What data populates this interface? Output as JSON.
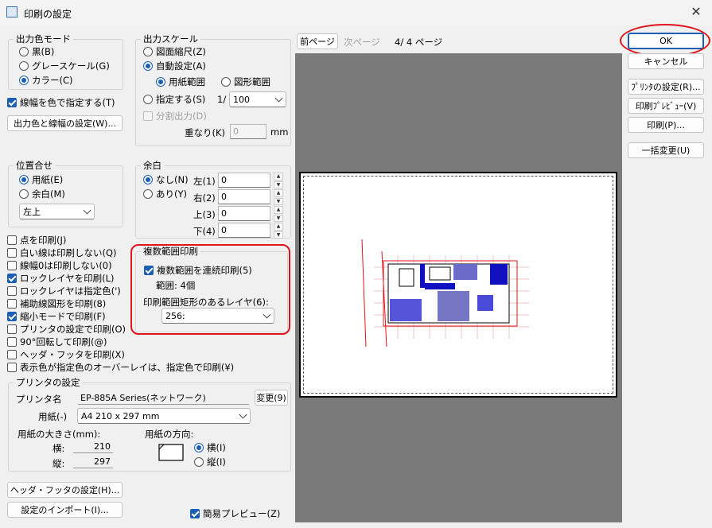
{
  "window": {
    "title": "印刷の設定",
    "close_glyph": "✕"
  },
  "color_mode": {
    "legend": "出力色モード",
    "options": [
      "黒(B)",
      "グレースケール(G)",
      "カラー(C)"
    ],
    "selected": 2
  },
  "line_width_checkbox": {
    "label": "線幅を色で指定する(T)",
    "checked": true
  },
  "color_settings_button": "出力色と線幅の設定(W)...",
  "scale": {
    "legend": "出力スケール",
    "drawing_scale": "図面縮尺(Z)",
    "auto": "自動設定(A)",
    "auto_paper": "用紙範囲",
    "auto_figure": "図形範囲",
    "specify": "指定する(S)",
    "ratio_prefix": "1/",
    "ratio_value": "100",
    "split_output": "分割出力(D)",
    "overlap_label": "重なり(K)",
    "overlap_value": "0",
    "overlap_unit": "mm"
  },
  "position": {
    "legend": "位置合せ",
    "options": [
      "用紙(E)",
      "余白(M)"
    ],
    "selected": 0,
    "anchor": "左上"
  },
  "margin": {
    "legend": "余白",
    "none": "なし(N)",
    "yes": "あり(Y)",
    "fields": [
      {
        "label": "左(1)",
        "value": "0"
      },
      {
        "label": "右(2)",
        "value": "0"
      },
      {
        "label": "上(3)",
        "value": "0"
      },
      {
        "label": "下(4)",
        "value": "0"
      }
    ]
  },
  "options": [
    {
      "label": "点を印刷(J)",
      "checked": false
    },
    {
      "label": "白い線は印刷しない(Q)",
      "checked": false
    },
    {
      "label": "線幅0は印刷しない(0)",
      "checked": false
    },
    {
      "label": "ロックレイヤを印刷(L)",
      "checked": true
    },
    {
      "label": "ロックレイヤは指定色(')",
      "checked": false
    },
    {
      "label": "補助線図形を印刷(8)",
      "checked": false
    },
    {
      "label": "縮小モードで印刷(F)",
      "checked": true
    },
    {
      "label": "プリンタの設定で印刷(O)",
      "checked": false
    },
    {
      "label": "90°回転して印刷(@)",
      "checked": false
    },
    {
      "label": "ヘッダ・フッタを印刷(X)",
      "checked": false
    },
    {
      "label": "表示色が指定色のオーバーレイは、指定色で印刷(¥)",
      "checked": false
    }
  ],
  "multi_range": {
    "legend": "複数範囲印刷",
    "continuous": "複数範囲を連続印刷(5)",
    "range_count": "範囲: 4個",
    "layer_label": "印刷範囲矩形のあるレイヤ(6):",
    "layer_value": "256:"
  },
  "printer": {
    "legend": "プリンタの設定",
    "name_label": "プリンタ名",
    "name_value": "EP-885A Series(ネットワーク)",
    "change_button": "変更(9)",
    "paper_label": "用紙(-)",
    "paper_value": "A4 210 x 297 mm",
    "size_label": "用紙の大きさ(mm):",
    "width_label": "横:",
    "width_value": "210",
    "height_label": "縦:",
    "height_value": "297",
    "orientation_label": "用紙の方向:",
    "landscape": "横(I)",
    "portrait": "縦(I)"
  },
  "header_footer_button": "ヘッダ・フッタの設定(H)...",
  "import_button": "設定のインポート(I)...",
  "simple_preview": {
    "label": "簡易プレビュー(Z)",
    "checked": true
  },
  "page_nav": {
    "prev": "前ページ",
    "next": "次ページ",
    "status": "4/ 4 ページ"
  },
  "right_buttons": {
    "ok": "OK",
    "cancel": "キャンセル",
    "printer_settings": "ﾌﾟﾘﾝﾀの設定(R)...",
    "print_preview": "印刷ﾌﾟﾚﾋﾞｭｰ(V)",
    "print": "印刷(P)...",
    "bulk_change": "一括変更(U)"
  },
  "colors": {
    "accent": "#1a5fb4",
    "highlight": "#e0141b",
    "preview_bg": "#7a7a7a"
  }
}
